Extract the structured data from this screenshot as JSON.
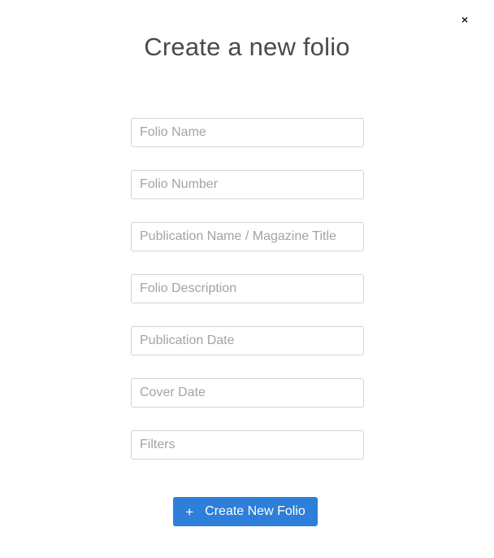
{
  "dialog": {
    "title": "Create a new folio",
    "close_label": "×"
  },
  "form": {
    "fields": [
      {
        "placeholder": "Folio Name",
        "value": ""
      },
      {
        "placeholder": "Folio Number",
        "value": ""
      },
      {
        "placeholder": "Publication Name / Magazine Title",
        "value": ""
      },
      {
        "placeholder": "Folio Description",
        "value": ""
      },
      {
        "placeholder": "Publication Date",
        "value": ""
      },
      {
        "placeholder": "Cover Date",
        "value": ""
      },
      {
        "placeholder": "Filters",
        "value": ""
      }
    ],
    "submit_label": "Create New Folio",
    "submit_icon": "+"
  },
  "colors": {
    "accent": "#2d7fd9",
    "title_text": "#4a4a4a",
    "placeholder_text": "#a3a3a3",
    "border": "#d4d4d4"
  }
}
